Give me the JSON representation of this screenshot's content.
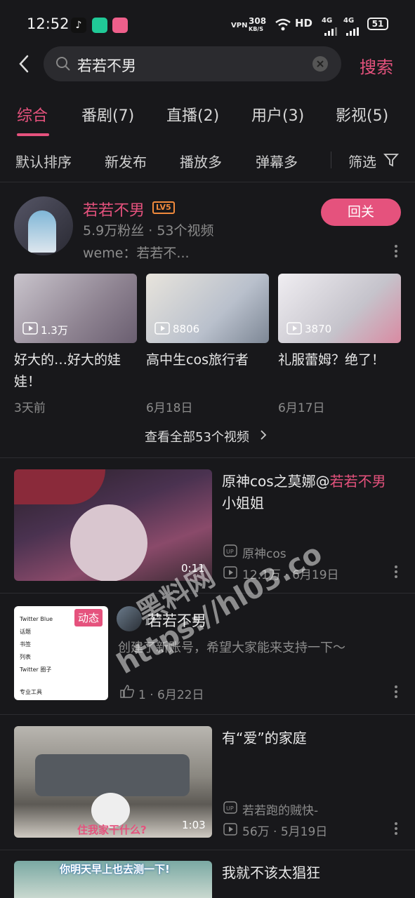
{
  "status": {
    "time": "12:52",
    "net_speed": "308",
    "net_unit": "KB/S",
    "vpn": "VPN",
    "hd": "HD",
    "sig1": "4G",
    "sig2": "4G",
    "battery": "51"
  },
  "search": {
    "query": "若若不男",
    "button": "搜索"
  },
  "tabs": [
    "综合",
    "番剧(7)",
    "直播(2)",
    "用户(3)",
    "影视(5)"
  ],
  "sort": {
    "options": [
      "默认排序",
      "新发布",
      "播放多",
      "弹幕多"
    ],
    "filter": "筛选"
  },
  "user": {
    "name": "若若不男",
    "level": "LV5",
    "stats": "5.9万粉丝 · 53个视频",
    "bio": "weme：若若不...",
    "follow_label": "回关"
  },
  "user_videos": [
    {
      "views": "1.3万",
      "title": "好大的…好大的娃娃！",
      "date": "3天前"
    },
    {
      "views": "8806",
      "title": "高中生cos旅行者",
      "date": "6月18日"
    },
    {
      "views": "3870",
      "title": "礼服蕾姆？绝了！",
      "date": "6月17日"
    }
  ],
  "see_all": "查看全部53个视频",
  "results": [
    {
      "title_pre": "原神cos之莫娜@",
      "title_hl": "若若不男",
      "title_post": " 小姐姐",
      "up": "原神cos",
      "views": "12.1万",
      "date": "6月19日",
      "duration": "0:11"
    },
    {
      "title_pre": "有“爱”的家庭",
      "up": "若若跑的贼快-",
      "views": "56万",
      "date": "5月19日",
      "duration": "1:03",
      "caption": "住我家干什么?"
    },
    {
      "title_pre": "我就不该太猖狂",
      "caption": "你明天早上也去测一下!"
    }
  ],
  "dynamic": {
    "badge": "动态",
    "author": "若若不男",
    "text": "创建了新账号，希望大家能来支持一下～",
    "likes": "1",
    "date": "6月22日",
    "menu": [
      "Twitter Blue",
      "话题",
      "书签",
      "列表",
      "Twitter 圈子",
      "专业工具"
    ]
  },
  "watermark": {
    "line1": "黑料网",
    "line2": "https://hl03.co"
  },
  "colors": {
    "accent": "#e5527d",
    "background": "#18181b"
  }
}
